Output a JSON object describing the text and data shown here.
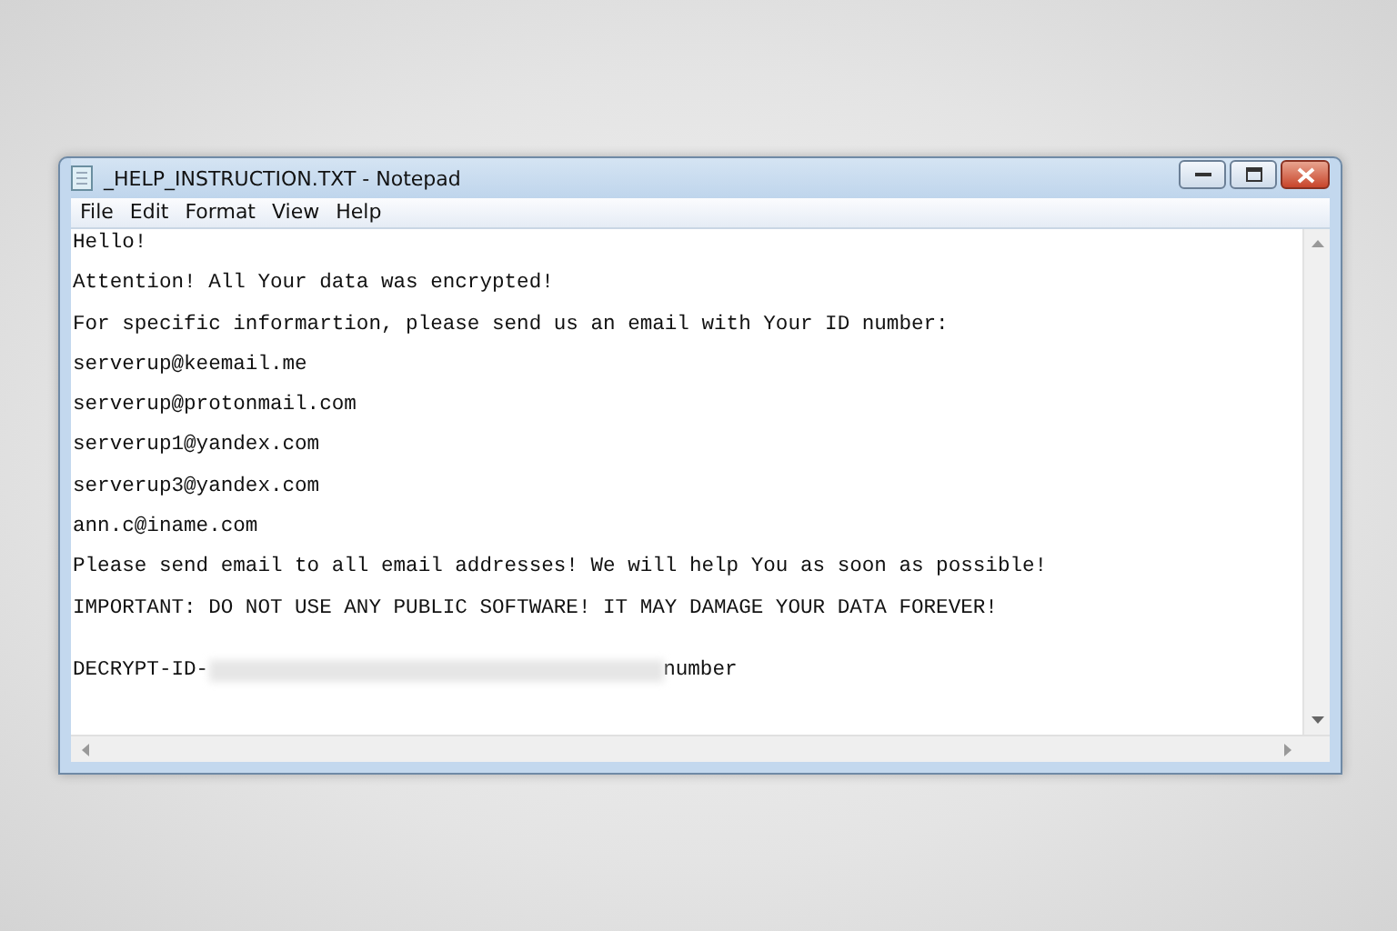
{
  "window": {
    "title": "_HELP_INSTRUCTION.TXT - Notepad"
  },
  "menu": [
    "File",
    "Edit",
    "Format",
    "View",
    "Help"
  ],
  "lines": [
    "Hello!",
    "Attention! All Your data was encrypted!",
    "For specific informartion, please send us an email with Your ID number:",
    "serverup@keemail.me",
    "serverup@protonmail.com",
    "serverup1@yandex.com",
    "serverup3@yandex.com",
    "ann.c@iname.com",
    "Please send email to all email addresses! We will help You as soon as possible!",
    "IMPORTANT: DO NOT USE ANY PUBLIC SOFTWARE! IT MAY DAMAGE YOUR DATA FOREVER!"
  ],
  "id_line": {
    "prefix": "DECRYPT-ID-",
    "suffix": "number",
    "redacted": true
  }
}
